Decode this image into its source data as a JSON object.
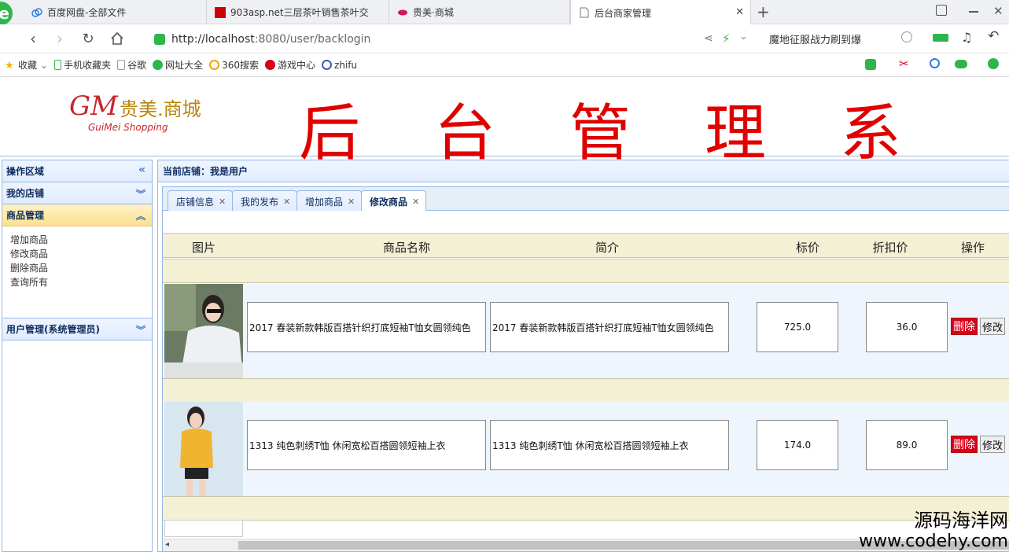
{
  "browser": {
    "tabs": [
      {
        "label": "百度网盘-全部文件",
        "active": false
      },
      {
        "label": "903asp.net三层茶叶销售茶叶交",
        "active": false
      },
      {
        "label": "贵美·商城",
        "active": false
      },
      {
        "label": "后台商家管理",
        "active": true
      }
    ],
    "new_tab": "+",
    "url_host": "http://localhost",
    "url_rest": ":8080/user/backlogin",
    "search_text": "魔地征服战力刷到爆"
  },
  "bookmarks": [
    "收藏",
    "手机收藏夹",
    "谷歌",
    "网址大全",
    "360搜索",
    "游戏中心",
    "zhifu"
  ],
  "header": {
    "brand_gm": "GM",
    "brand_cn": "贵美.商城",
    "brand_en": "GuiMei Shopping",
    "title_chars": [
      "后",
      "台",
      "管",
      "理",
      "系"
    ]
  },
  "sidebar": {
    "title": "操作区域",
    "sections": [
      {
        "label": "我的店铺"
      },
      {
        "label": "商品管理",
        "items": [
          "增加商品",
          "修改商品",
          "删除商品",
          "查询所有"
        ]
      },
      {
        "label": "用户管理(系统管理员)"
      }
    ]
  },
  "main": {
    "shop_label": "当前店铺：我是用户",
    "tabs": [
      "店铺信息",
      "我的发布",
      "增加商品",
      "修改商品"
    ],
    "columns": [
      "图片",
      "商品名称",
      "简介",
      "标价",
      "折扣价",
      "操作"
    ],
    "products": [
      {
        "name": "2017 春装新款韩版百搭针织打底短袖T恤女圆领纯色",
        "intro": "2017 春装新款韩版百搭针织打底短袖T恤女圆领纯色",
        "price": "725.0",
        "discount": "36.0"
      },
      {
        "name": "1313 纯色刺绣T恤 休闲宽松百搭圆领短袖上衣",
        "intro": "1313 纯色刺绣T恤 休闲宽松百搭圆领短袖上衣",
        "price": "174.0",
        "discount": "89.0"
      }
    ],
    "delete_label": "删除",
    "modify_label": "修改"
  },
  "watermark": {
    "line1": "源码海洋网",
    "line2": "www.codehy.com"
  },
  "colors": {
    "title_red": "#e00000",
    "panel_border": "#95b8e7",
    "band": "#f3f0d4",
    "delete_red": "#d9001b"
  }
}
